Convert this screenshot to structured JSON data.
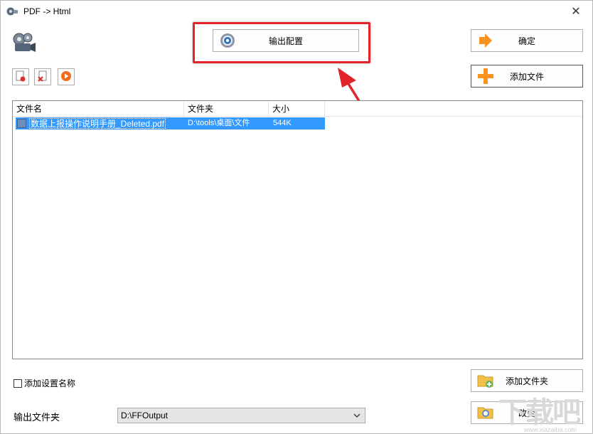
{
  "window": {
    "title": "PDF -> Html",
    "close_glyph": "✕"
  },
  "buttons": {
    "output_config": "输出配置",
    "ok": "确定",
    "add_file": "添加文件",
    "add_folder": "添加文件夹",
    "change": "改变"
  },
  "file_list": {
    "columns": [
      "文件名",
      "文件夹",
      "大小"
    ],
    "rows": [
      {
        "name": "数据上报操作说明手册_Deleted.pdf",
        "folder": "D:\\tools\\桌面\\文件",
        "size": "544K",
        "selected": true
      }
    ]
  },
  "options": {
    "add_setting_name_label": "添加设置名称",
    "output_folder_label": "输出文件夹",
    "output_folder_value": "D:\\FFOutput"
  },
  "icons": {
    "app": "film-reel-icon",
    "logo": "film-camera-icon",
    "config": "gear-icon",
    "ok": "arrow-right-icon",
    "add_file": "plus-icon",
    "add_folder": "folder-add-icon",
    "change": "folder-open-icon",
    "tool_delete": "document-delete-icon",
    "tool_clear": "document-remove-icon",
    "tool_play": "play-icon"
  },
  "colors": {
    "highlight": "#e0242a",
    "selection": "#3399ff",
    "accent_orange": "#f7931e"
  },
  "watermark": {
    "text": "下载吧",
    "url": "www.xiazaiba.com"
  }
}
